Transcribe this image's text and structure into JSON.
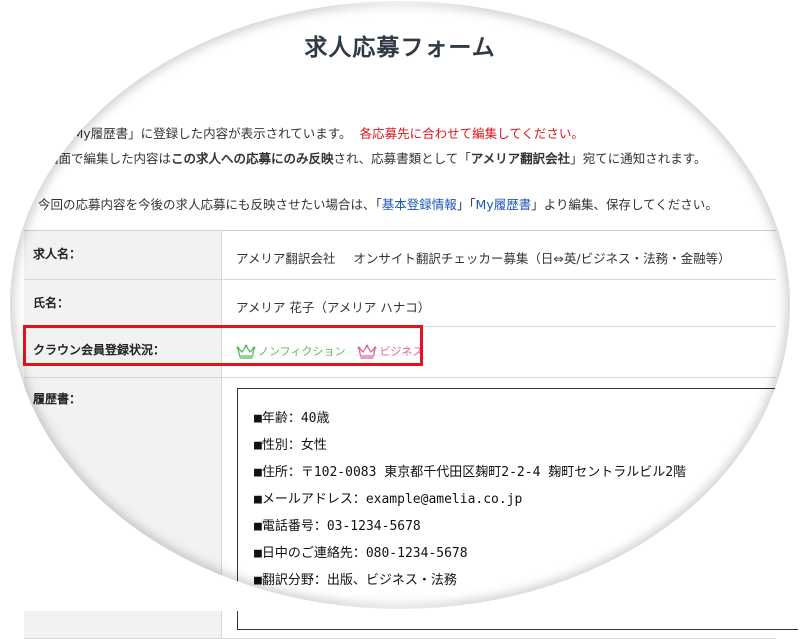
{
  "page_title": "求人応募フォーム",
  "notice": {
    "line1_prefix": "「My履歴書」に登録した内容が表示されています。",
    "line1_red": "各応募先に合わせて編集してください。",
    "line2_a": "画面で編集した内容は",
    "line2_bold": "この求人への応募にのみ反映",
    "line2_b": "され、応募書類として「",
    "line2_company": "アメリア翻訳会社",
    "line2_c": "」宛てに通知されます。",
    "line3_a": "今回の応募内容を今後の求人応募にも反映させたい場合は、「",
    "line3_link1": "基本登録情報",
    "line3_b": "」「",
    "line3_link2": "My履歴書",
    "line3_c": "」より編集、保存してください。"
  },
  "form": {
    "job_label": "求人名：",
    "job_company": "アメリア翻訳会社",
    "job_title": "オンサイト翻訳チェッカー募集（日⇔英/ビジネス・法務・金融等）",
    "name_label": "氏名：",
    "name_value": "アメリア 花子（アメリア ハナコ）",
    "crown_label": "クラウン会員登録状況：",
    "crown_badges": [
      "ノンフィクション",
      "ビジネス"
    ],
    "resume_label": "履歴書："
  },
  "resume_lines": [
    "■年齢：40歳",
    "■性別：女性",
    "■住所：〒102-0083 東京都千代田区麹町2-2-4 麹町セントラルビル2階",
    "■メールアドレス：example@amelia.co.jp",
    "■電話番号：03-1234-5678",
    "■日中のご連絡先：080-1234-5678",
    "■翻訳分野：出版、ビジネス・法務"
  ],
  "colors": {
    "highlight": "#e8101e",
    "notice_red": "#e0141e",
    "link": "#1a56b8",
    "badge_green": "#5cb85c",
    "badge_pink": "#e0669a"
  }
}
